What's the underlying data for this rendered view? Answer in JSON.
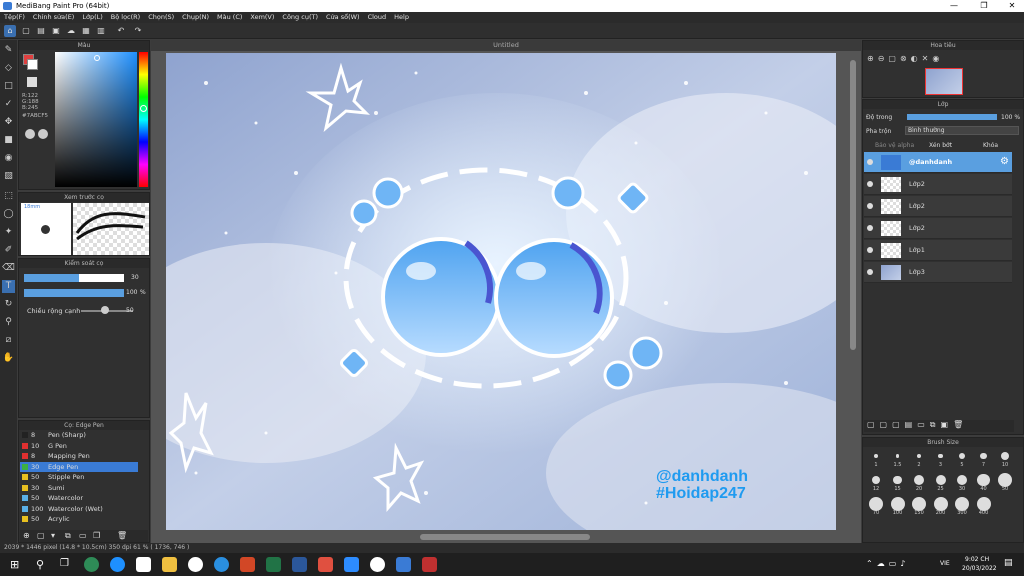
{
  "window": {
    "title": "MediBang Paint Pro (64bit)"
  },
  "menu": [
    "Tệp(F)",
    "Chỉnh sửa(E)",
    "Lớp(L)",
    "Bộ lọc(R)",
    "Chọn(S)",
    "Chụp(N)",
    "Màu (C)",
    "Xem(V)",
    "Công cụ(T)",
    "Cửa sổ(W)",
    "Cloud",
    "Help"
  ],
  "color_panel": {
    "title": "Màu",
    "r": "R:122",
    "g": "G:188",
    "b": "B:245",
    "hex": "#7ABCF5",
    "accent": "#7ABCF5"
  },
  "preview_panel": {
    "title": "Xem trước cọ",
    "size": "18mm"
  },
  "brush_control": {
    "title": "Kiểm soát cọ",
    "size_value": "30",
    "opacity_value": "100",
    "opacity_unit": "%",
    "width_label": "Chiều rộng cạnh",
    "width_value": "50"
  },
  "brush_panel": {
    "title": "Cọ: Edge Pen",
    "items": [
      {
        "size": "8",
        "name": "Pen (Sharp)",
        "color": "#222222"
      },
      {
        "size": "10",
        "name": "G Pen",
        "color": "#e03030"
      },
      {
        "size": "8",
        "name": "Mapping Pen",
        "color": "#e03030"
      },
      {
        "size": "30",
        "name": "Edge Pen",
        "color": "#3cb043"
      },
      {
        "size": "50",
        "name": "Stipple Pen",
        "color": "#e8c020"
      },
      {
        "size": "30",
        "name": "Sumi",
        "color": "#e8c020"
      },
      {
        "size": "50",
        "name": "Watercolor",
        "color": "#5ab0e8"
      },
      {
        "size": "100",
        "name": "Watercolor (Wet)",
        "color": "#5ab0e8"
      },
      {
        "size": "50",
        "name": "Acrylic",
        "color": "#e8c020"
      }
    ]
  },
  "document": {
    "tab": "Untitled"
  },
  "artwork": {
    "line1": "@danhdanh",
    "line2": "#Hoidap247"
  },
  "navigator": {
    "title": "Hoa tiêu"
  },
  "layer_panel": {
    "title": "Lớp",
    "opacity_label": "Độ trong",
    "opacity_value": "100 %",
    "blend_label": "Pha trộn",
    "blend_value": "Bình thường",
    "protect_alpha": "Bảo vệ alpha",
    "clipping": "Xén bớt",
    "lock": "Khóa",
    "layers": [
      "@danhdanh",
      "Lớp2",
      "Lớp2",
      "Lớp2",
      "Lớp1",
      "Lớp3"
    ]
  },
  "brush_size": {
    "title": "Brush Size",
    "values": [
      "1",
      "1.5",
      "2",
      "3",
      "5",
      "7",
      "10",
      "12",
      "15",
      "20",
      "25",
      "30",
      "40",
      "50",
      "70",
      "100",
      "150",
      "200",
      "300",
      "400"
    ]
  },
  "status": {
    "text": "2039 * 1446 pixel  (14.8 * 10.5cm)  350 dpi  61 %  ( 1736, 746 )"
  },
  "taskbar": {
    "time": "9:02 CH",
    "date": "20/03/2022",
    "lang": "VIE"
  }
}
